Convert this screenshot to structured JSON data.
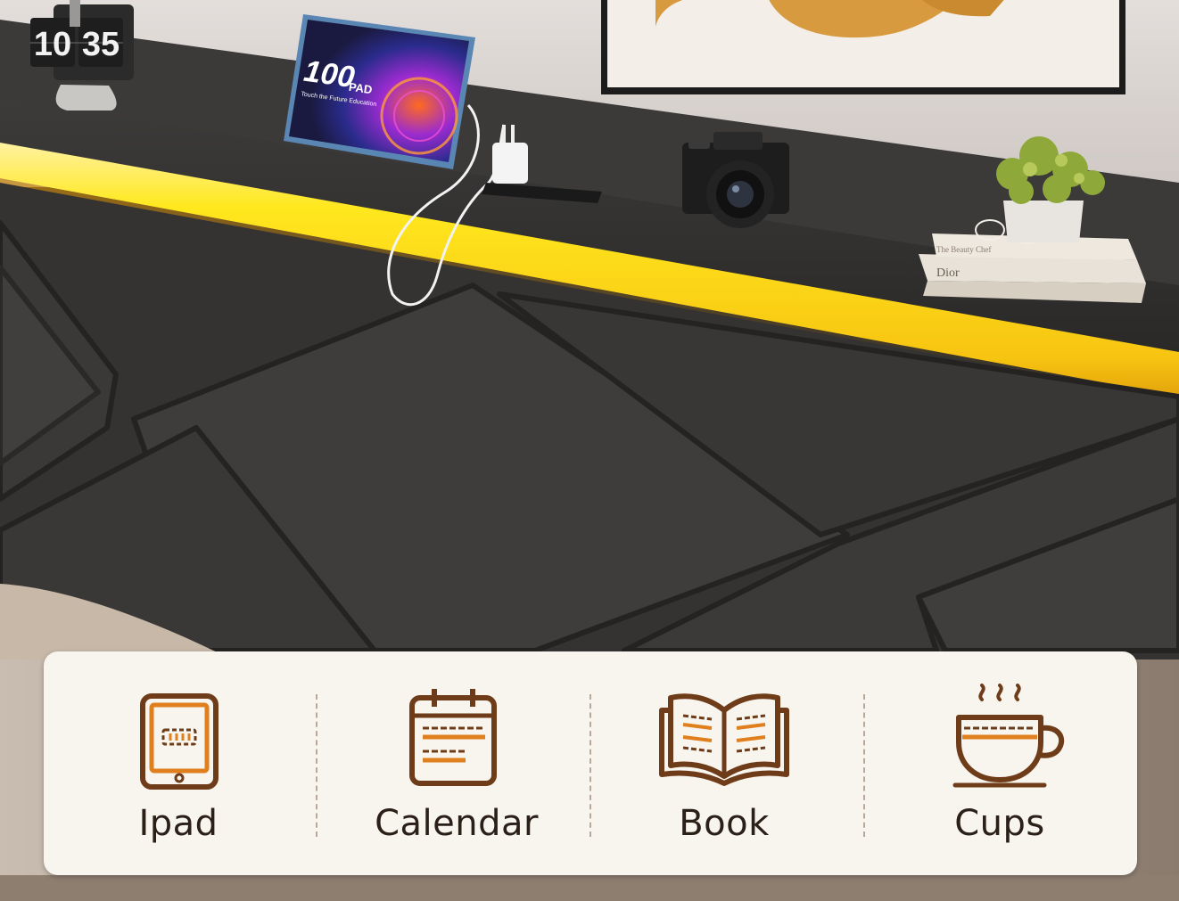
{
  "scene": {
    "clock_display": {
      "hours": "10",
      "minutes": "35"
    },
    "tablet_screen": {
      "brand": "100",
      "brand_suffix": "PAD",
      "tagline": "Touch the Future Education"
    },
    "book_titles": [
      "The Beauty Chef",
      "Dior"
    ]
  },
  "colors": {
    "wall": "#d9d3d0",
    "headboard": "#3a3938",
    "shelf": "#2e2d2c",
    "led": "#ffe51c",
    "card_bg": "#f8f4ee",
    "icon_brown": "#6e3c19",
    "icon_orange": "#e07f1d",
    "label_text": "#2a2018"
  },
  "features": [
    {
      "label": "Ipad",
      "icon": "tablet-icon"
    },
    {
      "label": "Calendar",
      "icon": "calendar-icon"
    },
    {
      "label": "Book",
      "icon": "open-book-icon"
    },
    {
      "label": "Cups",
      "icon": "coffee-cup-icon"
    }
  ]
}
